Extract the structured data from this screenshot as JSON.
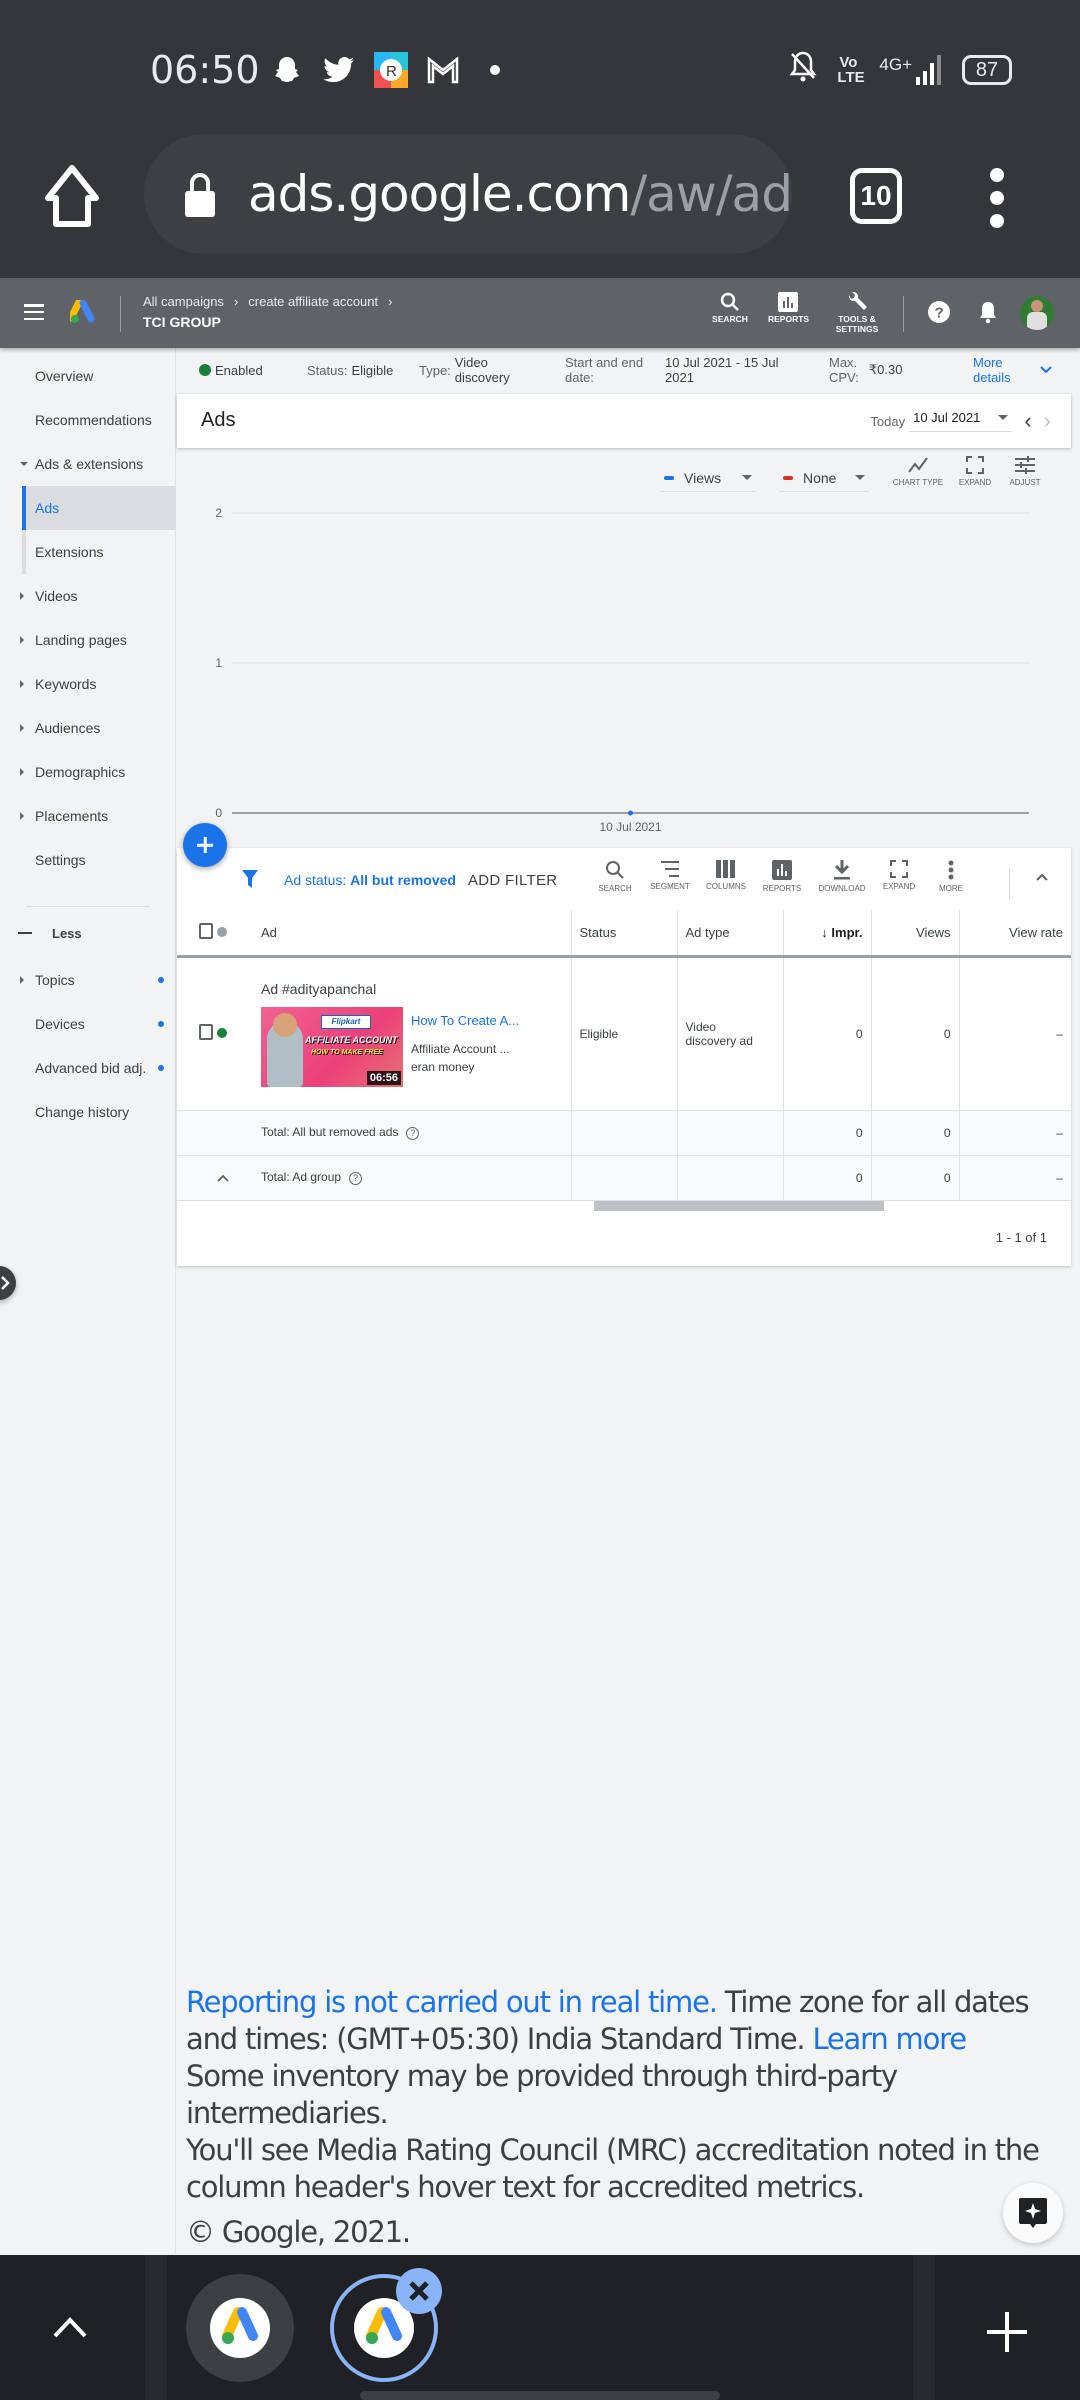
{
  "status_bar": {
    "time": "06:50",
    "notification_icons": [
      "snapchat-icon",
      "twitter-icon",
      "realme-icon",
      "gmail-icon",
      "more-dot-icon"
    ],
    "system_icons": [
      "bell-off-icon",
      "volte-icon",
      "signal-4g-plus-icon"
    ],
    "volte_label": "Vo LTE",
    "network_label": "4G+",
    "battery": "87"
  },
  "browser": {
    "url_host": "ads.google.com",
    "url_path": "/aw/ads",
    "tab_count": "10"
  },
  "ads_header": {
    "breadcrumbs": [
      "All campaigns",
      "create affiliate account"
    ],
    "account": "TCI GROUP",
    "tools": [
      {
        "label": "SEARCH",
        "icon": "search-icon"
      },
      {
        "label": "REPORTS",
        "icon": "reports-icon"
      },
      {
        "label": "TOOLS &\nSETTINGS",
        "label_line1": "TOOLS &",
        "label_line2": "SETTINGS",
        "icon": "wrench-icon"
      }
    ]
  },
  "sidebar": {
    "items": [
      {
        "label": "Overview"
      },
      {
        "label": "Recommendations"
      },
      {
        "label": "Ads & extensions",
        "expanded": true
      },
      {
        "label": "Ads",
        "active": true
      },
      {
        "label": "Extensions"
      },
      {
        "label": "Videos"
      },
      {
        "label": "Landing pages"
      },
      {
        "label": "Keywords"
      },
      {
        "label": "Audiences"
      },
      {
        "label": "Demographics"
      },
      {
        "label": "Placements"
      },
      {
        "label": "Settings"
      }
    ],
    "less_label": "Less",
    "more_items": [
      {
        "label": "Topics",
        "dot": true
      },
      {
        "label": "Devices",
        "dot": true
      },
      {
        "label": "Advanced bid adj.",
        "dot": true
      },
      {
        "label": "Change history"
      }
    ]
  },
  "summary": {
    "state": "Enabled",
    "status_label": "Status:",
    "status_value": "Eligible",
    "type_label": "Type:",
    "type_value_1": "Video",
    "type_value_2": "discovery",
    "dates_label_1": "Start and end",
    "dates_label_2": "date:",
    "dates_value_1": "10 Jul 2021 - 15 Jul",
    "dates_value_2": "2021",
    "cpv_label_1": "Max.",
    "cpv_label_2": "CPV:",
    "cpv_value": "₹0.30",
    "more_1": "More",
    "more_2": "details"
  },
  "ads_card": {
    "title": "Ads",
    "today_label": "Today",
    "date_value": "10 Jul 2021"
  },
  "chart_controls": {
    "metric1": "Views",
    "metric1_color": "#1a73e8",
    "metric2": "None",
    "metric2_color": "#d93025",
    "chart_type_label": "CHART TYPE",
    "expand_label": "EXPAND",
    "adjust_label": "ADJUST"
  },
  "chart_data": {
    "type": "line",
    "title": "",
    "x": [
      "10 Jul 2021"
    ],
    "series": [
      {
        "name": "Views",
        "values": [
          0
        ],
        "color": "#1a73e8"
      }
    ],
    "xlabel": "",
    "ylabel": "",
    "ylim": [
      0,
      2
    ],
    "yticks": [
      0,
      1,
      2
    ],
    "grid": true,
    "legend": "top-right"
  },
  "table_toolbar": {
    "filter_prefix": "Ad status: ",
    "filter_value": "All but removed",
    "add_filter": "ADD FILTER",
    "tools": [
      "SEARCH",
      "SEGMENT",
      "COLUMNS",
      "REPORTS",
      "DOWNLOAD",
      "EXPAND",
      "MORE"
    ]
  },
  "table": {
    "columns": [
      "Ad",
      "Status",
      "Ad type",
      "Impr.",
      "Views",
      "View rate"
    ],
    "sorted_column": "Impr.",
    "rows": [
      {
        "ad_name": "Ad #adityapanchal",
        "thumbnail_brand": "Flipkart",
        "thumbnail_line1": "AFFILIATE ACCOUNT",
        "thumbnail_line2": "HOW TO MAKE FREE",
        "duration": "06:56",
        "headline": "How To Create A...",
        "description_1": "Affiliate Account ...",
        "description_2": "eran money",
        "status": "Eligible",
        "ad_type_1": "Video",
        "ad_type_2": "discovery ad",
        "impr": "0",
        "views": "0",
        "view_rate": "–"
      }
    ],
    "totals": [
      {
        "label": "Total: All but removed ads",
        "impr": "0",
        "views": "0",
        "view_rate": "–"
      },
      {
        "label": "Total: Ad group",
        "impr": "0",
        "views": "0",
        "view_rate": "–"
      }
    ],
    "pagination": "1 - 1 of 1"
  },
  "footer": {
    "realtime_link": "Reporting is not carried out in real time.",
    "timezone_text": " Time zone for all dates and times: (GMT+05:30) India Standard Time. ",
    "learn_more": "Learn more",
    "inventory_text": "Some inventory may be provided through third-party intermediaries.",
    "mrc_text": "You'll see Media Rating Council (MRC) accreditation noted in the column header's hover text for accredited metrics.",
    "copyright": "© Google, 2021."
  },
  "tab_strip": {
    "tabs": [
      {
        "title": "Google Ads",
        "active": false
      },
      {
        "title": "Google Ads",
        "active": true
      }
    ]
  }
}
